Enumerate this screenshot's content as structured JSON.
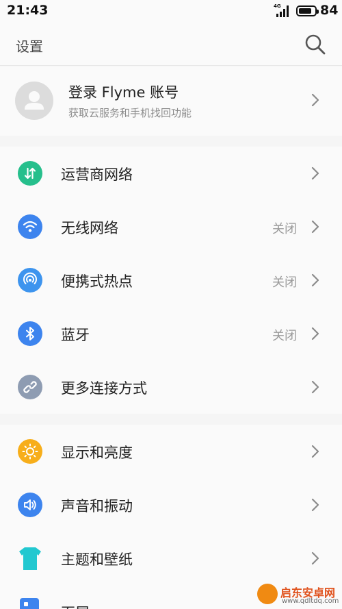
{
  "status_bar": {
    "time": "21:43",
    "network_tag": "4G",
    "battery_percent": 84,
    "battery_label": "84"
  },
  "header": {
    "title": "设置"
  },
  "account": {
    "title": "登录 Flyme 账号",
    "subtitle": "获取云服务和手机找回功能"
  },
  "group1": [
    {
      "label": "运营商网络",
      "status": "",
      "icon": "carrier-icon",
      "color": "#26bf8c"
    },
    {
      "label": "无线网络",
      "status": "关闭",
      "icon": "wifi-icon",
      "color": "#3d84ee"
    },
    {
      "label": "便携式热点",
      "status": "关闭",
      "icon": "hotspot-icon",
      "color": "#3d94ee"
    },
    {
      "label": "蓝牙",
      "status": "关闭",
      "icon": "bluetooth-icon",
      "color": "#3d84ee"
    },
    {
      "label": "更多连接方式",
      "status": "",
      "icon": "link-icon",
      "color": "#8e9cb2"
    }
  ],
  "group2": [
    {
      "label": "显示和亮度",
      "status": "",
      "icon": "brightness-icon",
      "color": "#f7ae1a"
    },
    {
      "label": "声音和振动",
      "status": "",
      "icon": "sound-icon",
      "color": "#3d84ee"
    },
    {
      "label": "主题和壁纸",
      "status": "",
      "icon": "theme-icon",
      "color": "#22c8d0"
    },
    {
      "label": "页屏",
      "status": "",
      "icon": "home-screen-icon",
      "color": "#3d84ee"
    }
  ],
  "watermark": {
    "name": "启东安卓网",
    "url": "www.qdltdq.com"
  }
}
